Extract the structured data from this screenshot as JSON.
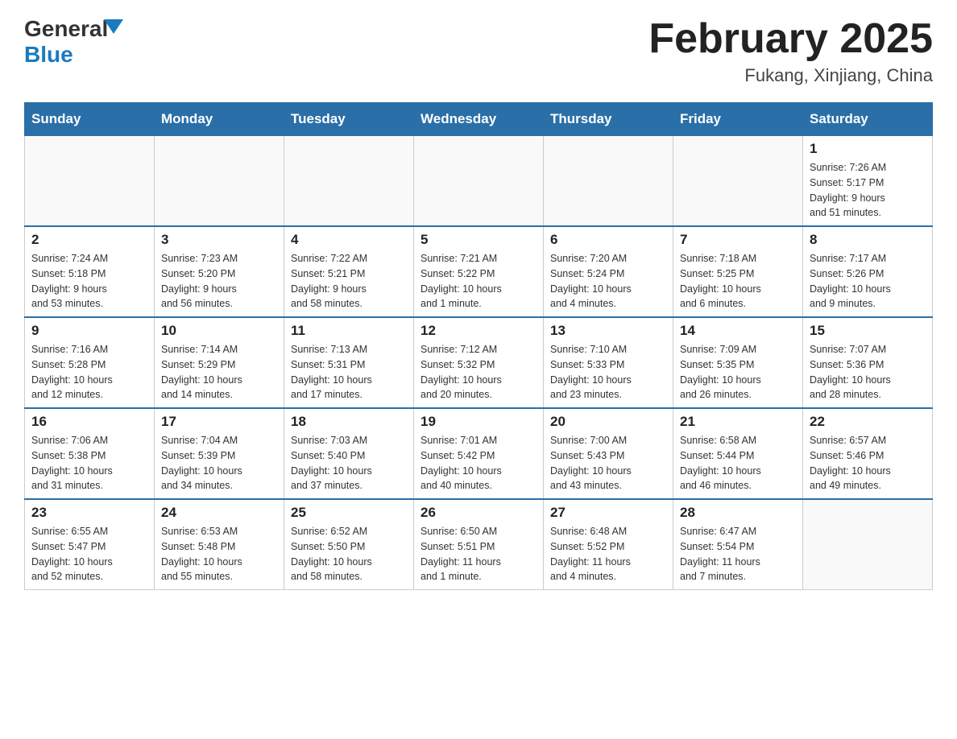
{
  "header": {
    "logo_general": "General",
    "logo_blue": "Blue",
    "month_title": "February 2025",
    "location": "Fukang, Xinjiang, China"
  },
  "weekdays": [
    "Sunday",
    "Monday",
    "Tuesday",
    "Wednesday",
    "Thursday",
    "Friday",
    "Saturday"
  ],
  "weeks": [
    [
      {
        "day": "",
        "info": ""
      },
      {
        "day": "",
        "info": ""
      },
      {
        "day": "",
        "info": ""
      },
      {
        "day": "",
        "info": ""
      },
      {
        "day": "",
        "info": ""
      },
      {
        "day": "",
        "info": ""
      },
      {
        "day": "1",
        "info": "Sunrise: 7:26 AM\nSunset: 5:17 PM\nDaylight: 9 hours\nand 51 minutes."
      }
    ],
    [
      {
        "day": "2",
        "info": "Sunrise: 7:24 AM\nSunset: 5:18 PM\nDaylight: 9 hours\nand 53 minutes."
      },
      {
        "day": "3",
        "info": "Sunrise: 7:23 AM\nSunset: 5:20 PM\nDaylight: 9 hours\nand 56 minutes."
      },
      {
        "day": "4",
        "info": "Sunrise: 7:22 AM\nSunset: 5:21 PM\nDaylight: 9 hours\nand 58 minutes."
      },
      {
        "day": "5",
        "info": "Sunrise: 7:21 AM\nSunset: 5:22 PM\nDaylight: 10 hours\nand 1 minute."
      },
      {
        "day": "6",
        "info": "Sunrise: 7:20 AM\nSunset: 5:24 PM\nDaylight: 10 hours\nand 4 minutes."
      },
      {
        "day": "7",
        "info": "Sunrise: 7:18 AM\nSunset: 5:25 PM\nDaylight: 10 hours\nand 6 minutes."
      },
      {
        "day": "8",
        "info": "Sunrise: 7:17 AM\nSunset: 5:26 PM\nDaylight: 10 hours\nand 9 minutes."
      }
    ],
    [
      {
        "day": "9",
        "info": "Sunrise: 7:16 AM\nSunset: 5:28 PM\nDaylight: 10 hours\nand 12 minutes."
      },
      {
        "day": "10",
        "info": "Sunrise: 7:14 AM\nSunset: 5:29 PM\nDaylight: 10 hours\nand 14 minutes."
      },
      {
        "day": "11",
        "info": "Sunrise: 7:13 AM\nSunset: 5:31 PM\nDaylight: 10 hours\nand 17 minutes."
      },
      {
        "day": "12",
        "info": "Sunrise: 7:12 AM\nSunset: 5:32 PM\nDaylight: 10 hours\nand 20 minutes."
      },
      {
        "day": "13",
        "info": "Sunrise: 7:10 AM\nSunset: 5:33 PM\nDaylight: 10 hours\nand 23 minutes."
      },
      {
        "day": "14",
        "info": "Sunrise: 7:09 AM\nSunset: 5:35 PM\nDaylight: 10 hours\nand 26 minutes."
      },
      {
        "day": "15",
        "info": "Sunrise: 7:07 AM\nSunset: 5:36 PM\nDaylight: 10 hours\nand 28 minutes."
      }
    ],
    [
      {
        "day": "16",
        "info": "Sunrise: 7:06 AM\nSunset: 5:38 PM\nDaylight: 10 hours\nand 31 minutes."
      },
      {
        "day": "17",
        "info": "Sunrise: 7:04 AM\nSunset: 5:39 PM\nDaylight: 10 hours\nand 34 minutes."
      },
      {
        "day": "18",
        "info": "Sunrise: 7:03 AM\nSunset: 5:40 PM\nDaylight: 10 hours\nand 37 minutes."
      },
      {
        "day": "19",
        "info": "Sunrise: 7:01 AM\nSunset: 5:42 PM\nDaylight: 10 hours\nand 40 minutes."
      },
      {
        "day": "20",
        "info": "Sunrise: 7:00 AM\nSunset: 5:43 PM\nDaylight: 10 hours\nand 43 minutes."
      },
      {
        "day": "21",
        "info": "Sunrise: 6:58 AM\nSunset: 5:44 PM\nDaylight: 10 hours\nand 46 minutes."
      },
      {
        "day": "22",
        "info": "Sunrise: 6:57 AM\nSunset: 5:46 PM\nDaylight: 10 hours\nand 49 minutes."
      }
    ],
    [
      {
        "day": "23",
        "info": "Sunrise: 6:55 AM\nSunset: 5:47 PM\nDaylight: 10 hours\nand 52 minutes."
      },
      {
        "day": "24",
        "info": "Sunrise: 6:53 AM\nSunset: 5:48 PM\nDaylight: 10 hours\nand 55 minutes."
      },
      {
        "day": "25",
        "info": "Sunrise: 6:52 AM\nSunset: 5:50 PM\nDaylight: 10 hours\nand 58 minutes."
      },
      {
        "day": "26",
        "info": "Sunrise: 6:50 AM\nSunset: 5:51 PM\nDaylight: 11 hours\nand 1 minute."
      },
      {
        "day": "27",
        "info": "Sunrise: 6:48 AM\nSunset: 5:52 PM\nDaylight: 11 hours\nand 4 minutes."
      },
      {
        "day": "28",
        "info": "Sunrise: 6:47 AM\nSunset: 5:54 PM\nDaylight: 11 hours\nand 7 minutes."
      },
      {
        "day": "",
        "info": ""
      }
    ]
  ]
}
